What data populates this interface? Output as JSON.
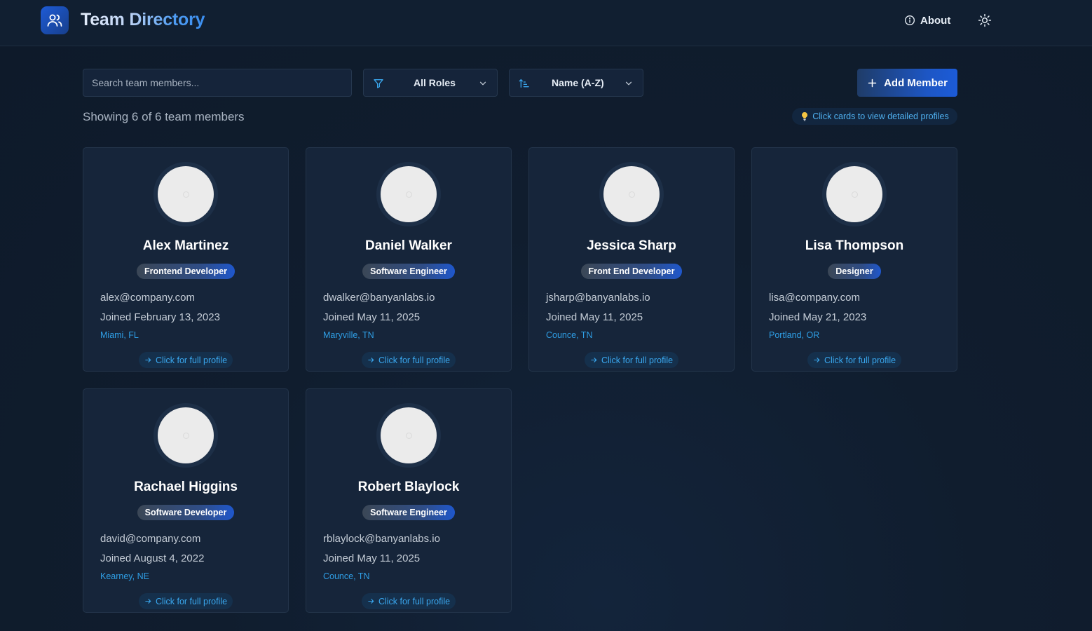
{
  "header": {
    "title": "Team Directory",
    "about_label": "About"
  },
  "toolbar": {
    "search_placeholder": "Search team members...",
    "role_filter": "All Roles",
    "sort": "Name (A-Z)",
    "add_label": "Add Member"
  },
  "summary": {
    "count_text": "Showing 6 of 6 team members",
    "hint_text": "Click cards to view detailed profiles"
  },
  "members": [
    {
      "name": "Alex Martinez",
      "role": "Frontend Developer",
      "email": "alex@company.com",
      "joined": "Joined February 13, 2023",
      "location": "Miami, FL",
      "link": "Click for full profile"
    },
    {
      "name": "Daniel Walker",
      "role": "Software Engineer",
      "email": "dwalker@banyanlabs.io",
      "joined": "Joined May 11, 2025",
      "location": "Maryville, TN",
      "link": "Click for full profile"
    },
    {
      "name": "Jessica Sharp",
      "role": "Front End Developer",
      "email": "jsharp@banyanlabs.io",
      "joined": "Joined May 11, 2025",
      "location": "Counce, TN",
      "link": "Click for full profile"
    },
    {
      "name": "Lisa Thompson",
      "role": "Designer",
      "email": "lisa@company.com",
      "joined": "Joined May 21, 2023",
      "location": "Portland, OR",
      "link": "Click for full profile"
    },
    {
      "name": "Rachael Higgins",
      "role": "Software Developer",
      "email": "david@company.com",
      "joined": "Joined August 4, 2022",
      "location": "Kearney, NE",
      "link": "Click for full profile"
    },
    {
      "name": "Robert Blaylock",
      "role": "Software Engineer",
      "email": "rblaylock@banyanlabs.io",
      "joined": "Joined May 11, 2025",
      "location": "Counce, TN",
      "link": "Click for full profile"
    }
  ],
  "colors": {
    "accent": "#1d56c4",
    "link": "#3aa7ee",
    "background": "#0e1a2a"
  },
  "icons": {
    "logo": "users-icon",
    "about": "info-icon",
    "theme": "sun-icon",
    "filter": "filter-icon",
    "sort": "sort-ascending-icon",
    "add": "plus-icon",
    "hint": "lightbulb-icon",
    "link": "arrow-right-icon"
  }
}
